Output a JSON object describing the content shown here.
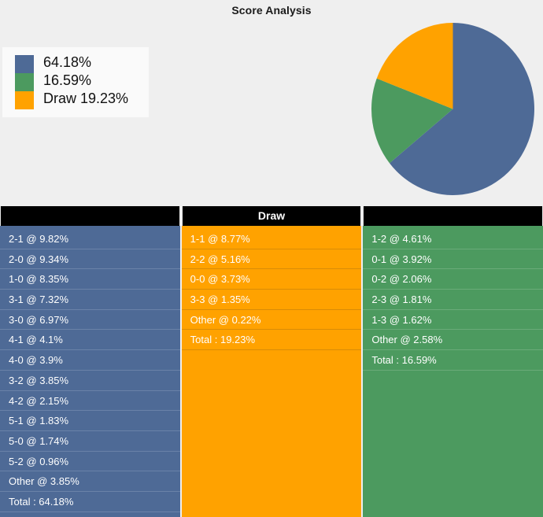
{
  "chart": {
    "title": "Score Analysis",
    "background": "#efefef",
    "legend": {
      "box_background": "#fafafa",
      "items": [
        {
          "label": "64.18%",
          "color": "#4e6a96",
          "swatch_name": "home-win-swatch"
        },
        {
          "label": "16.59%",
          "color": "#4c9a5f",
          "swatch_name": "away-win-swatch"
        },
        {
          "label": "Draw 19.23%",
          "color": "#ffa200",
          "swatch_name": "draw-swatch"
        }
      ]
    }
  },
  "chart_data": {
    "type": "pie",
    "title": "Score Analysis",
    "labels": [
      "64.18%",
      "16.59%",
      "Draw 19.23%"
    ],
    "values": [
      64.18,
      16.59,
      19.23
    ],
    "colors": [
      "#4e6a96",
      "#4c9a5f",
      "#ffa200"
    ],
    "start_angle": 0,
    "direction": "clockwise",
    "legend_position": "top-left",
    "grid": false
  },
  "table": {
    "header_background": "#000000",
    "columns": [
      {
        "name": "home-win-column",
        "header": "",
        "color": "#4e6a96",
        "rows": [
          "2-1 @ 9.82%",
          "2-0 @ 9.34%",
          "1-0 @ 8.35%",
          "3-1 @ 7.32%",
          "3-0 @ 6.97%",
          "4-1 @ 4.1%",
          "4-0 @ 3.9%",
          "3-2 @ 3.85%",
          "4-2 @ 2.15%",
          "5-1 @ 1.83%",
          "5-0 @ 1.74%",
          "5-2 @ 0.96%",
          "Other @ 3.85%",
          "Total : 64.18%"
        ]
      },
      {
        "name": "draw-column",
        "header": "Draw",
        "color": "#ffa200",
        "rows": [
          "1-1 @ 8.77%",
          "2-2 @ 5.16%",
          "0-0 @ 3.73%",
          "3-3 @ 1.35%",
          "Other @ 0.22%",
          "Total : 19.23%"
        ]
      },
      {
        "name": "away-win-column",
        "header": "",
        "color": "#4c9a5f",
        "rows": [
          "1-2 @ 4.61%",
          "0-1 @ 3.92%",
          "0-2 @ 2.06%",
          "2-3 @ 1.81%",
          "1-3 @ 1.62%",
          "Other @ 2.58%",
          "Total : 16.59%"
        ]
      }
    ]
  }
}
